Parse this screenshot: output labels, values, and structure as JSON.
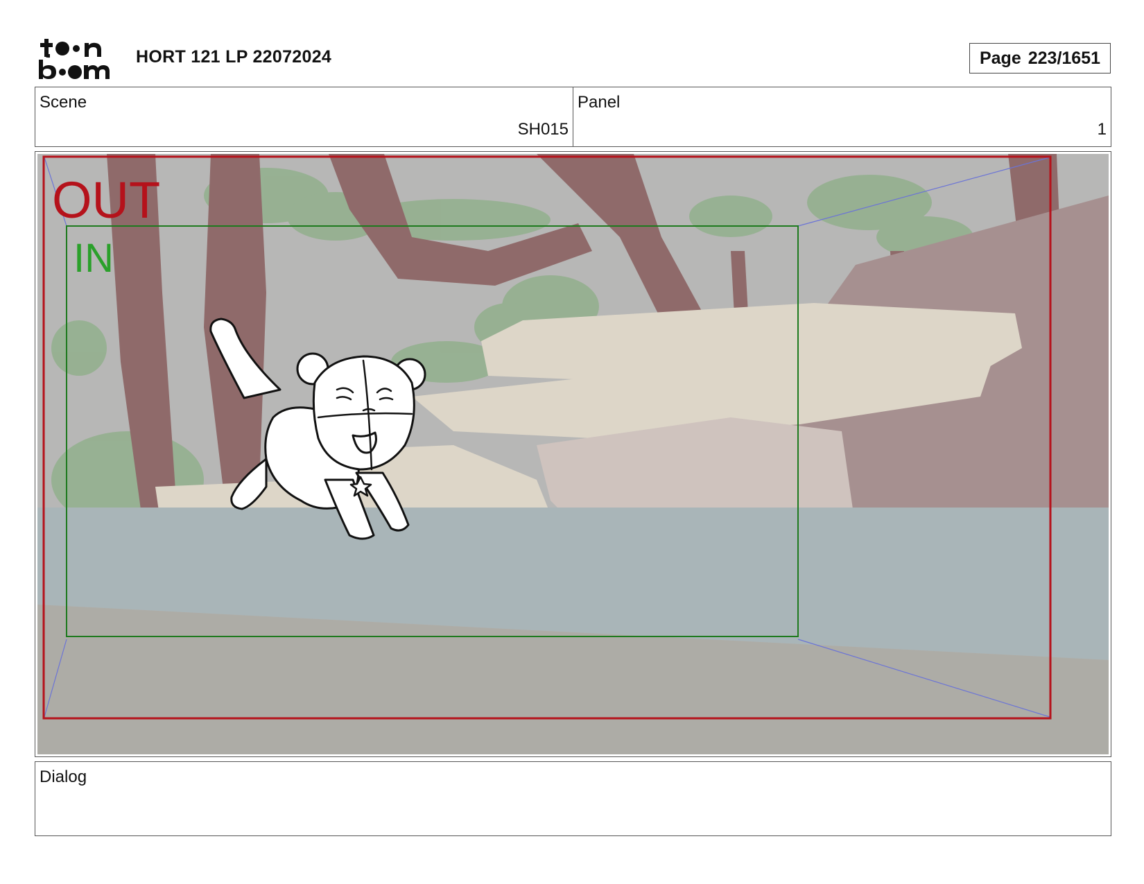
{
  "header": {
    "logo_text_top": "toon",
    "logo_text_bottom": "boom",
    "title": "HORT 121 LP 22072024",
    "page_label": "Page",
    "page_number": "223/1651"
  },
  "info": {
    "scene_label": "Scene",
    "scene_value": "SH015",
    "panel_label": "Panel",
    "panel_value": "1"
  },
  "frame": {
    "out_label": "OUT",
    "in_label": "IN",
    "colors": {
      "out_frame": "#b5121b",
      "in_frame": "#1e7a1e",
      "guide_lines": "#6b74d6"
    }
  },
  "dialog": {
    "label": "Dialog"
  }
}
